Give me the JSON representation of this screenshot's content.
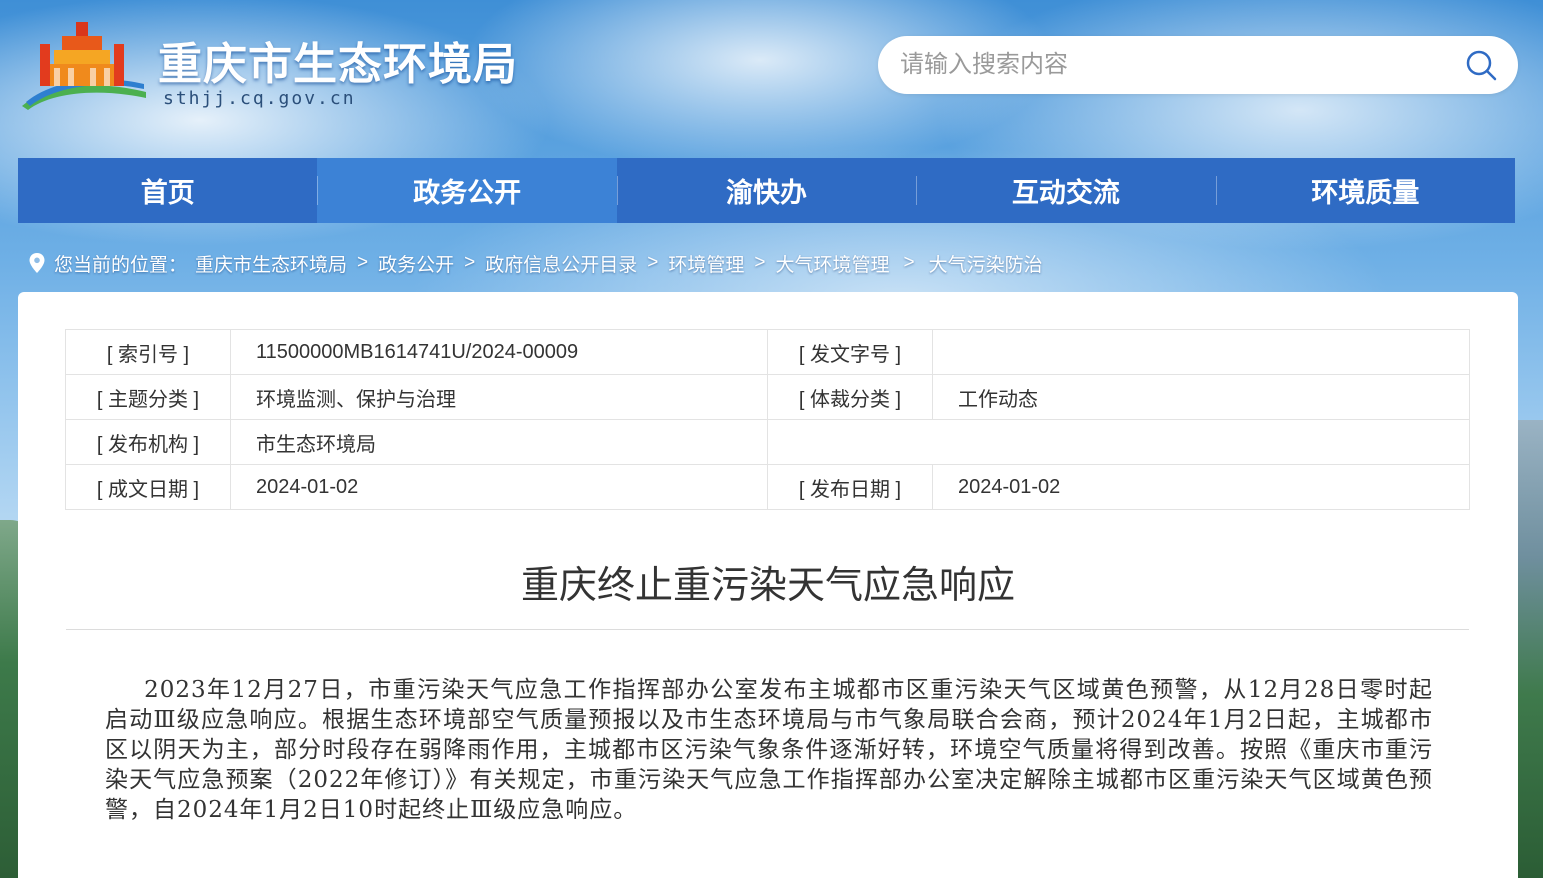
{
  "header": {
    "site_title": "重庆市生态环境局",
    "site_domain": "sthjj.cq.gov.cn",
    "logo_icon": "government-building-logo",
    "search": {
      "placeholder": "请输入搜索内容",
      "icon": "search-icon"
    }
  },
  "nav": {
    "items": [
      {
        "label": "首页",
        "active": false
      },
      {
        "label": "政务公开",
        "active": true
      },
      {
        "label": "渝快办",
        "active": false
      },
      {
        "label": "互动交流",
        "active": false
      },
      {
        "label": "环境质量",
        "active": false
      }
    ]
  },
  "breadcrumb": {
    "prefix": "您当前的位置：",
    "items": [
      "重庆市生态环境局",
      "政务公开",
      "政府信息公开目录",
      "环境管理",
      "大气环境管理",
      "大气污染防治"
    ],
    "separator": ">"
  },
  "meta": {
    "index_no_label": "[ 索引号 ]",
    "index_no_value": "11500000MB1614741U/2024-00009",
    "doc_no_label": "[ 发文字号 ]",
    "doc_no_value": "",
    "topic_label": "[ 主题分类 ]",
    "topic_value": "环境监测、保护与治理",
    "genre_label": "[ 体裁分类 ]",
    "genre_value": "工作动态",
    "publisher_label": "[ 发布机构 ]",
    "publisher_value": "市生态环境局",
    "created_label": "[ 成文日期 ]",
    "created_value": "2024-01-02",
    "published_label": "[ 发布日期 ]",
    "published_value": "2024-01-02"
  },
  "article": {
    "title": "重庆终止重污染天气应急响应",
    "body": "2023年12月27日，市重污染天气应急工作指挥部办公室发布主城都市区重污染天气区域黄色预警，从12月28日零时起启动Ⅲ级应急响应。根据生态环境部空气质量预报以及市生态环境局与市气象局联合会商，预计2024年1月2日起，主城都市区以阴天为主，部分时段存在弱降雨作用，主城都市区污染气象条件逐渐好转，环境空气质量将得到改善。按照《重庆市重污染天气应急预案（2022年修订）》有关规定，市重污染天气应急工作指挥部办公室决定解除主城都市区重污染天气区域黄色预警，自2024年1月2日10时起终止Ⅲ级应急响应。"
  },
  "colors": {
    "nav_bg": "#2f6bc4",
    "nav_active": "#3c82d6",
    "text": "#333333"
  }
}
